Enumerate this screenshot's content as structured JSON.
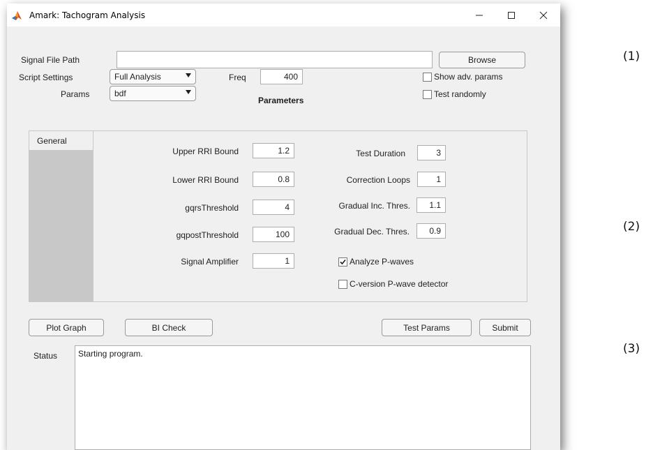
{
  "window": {
    "title": "Amark: Tachogram Analysis"
  },
  "file": {
    "label": "Signal File Path",
    "value": "",
    "browse_label": "Browse"
  },
  "script": {
    "label": "Script Settings",
    "selected": "Full Analysis"
  },
  "freq": {
    "label": "Freq",
    "value": "400"
  },
  "params": {
    "label": "Params",
    "selected": "bdf"
  },
  "options": {
    "show_adv": "Show adv. params",
    "test_randomly": "Test randomly"
  },
  "parameters_heading": "Parameters",
  "tab": {
    "label": "General"
  },
  "fields_left": [
    {
      "label": "Upper RRI Bound",
      "value": "1.2"
    },
    {
      "label": "Lower RRI Bound",
      "value": "0.8"
    },
    {
      "label": "gqrsThreshold",
      "value": "4"
    },
    {
      "label": "gqpostThreshold",
      "value": "100"
    },
    {
      "label": "Signal Amplifier",
      "value": "1"
    }
  ],
  "fields_right": [
    {
      "label": "Test Duration",
      "value": "3"
    },
    {
      "label": "Correction Loops",
      "value": "1"
    },
    {
      "label": "Gradual Inc. Thres.",
      "value": "1.1"
    },
    {
      "label": "Gradual Dec. Thres.",
      "value": "0.9"
    }
  ],
  "checkboxes": [
    {
      "label": "Analyze P-waves",
      "checked": true
    },
    {
      "label": "C-version P-wave detector",
      "checked": false
    }
  ],
  "buttons": {
    "plot": "Plot Graph",
    "bi_check": "BI Check",
    "test_params": "Test Params",
    "submit": "Submit"
  },
  "status": {
    "label": "Status",
    "text": "Starting program."
  },
  "side_labels": [
    "(1)",
    "(2)",
    "(3)"
  ],
  "colors": {
    "window_bg": "#f0f0f0",
    "tab_strip": "#c8c8c8",
    "matlab_icon": "#d9531e"
  }
}
